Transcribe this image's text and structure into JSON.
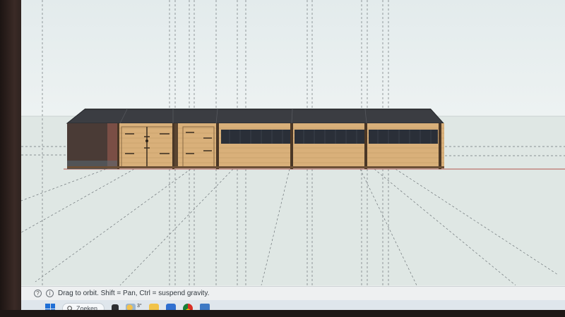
{
  "status_bar": {
    "info_icon": "info-circle-icon",
    "hint_text": "Drag to orbit. Shift = Pan, Ctrl = suspend gravity."
  },
  "taskbar": {
    "search_placeholder": "Zoeken",
    "weather_temp": "3°",
    "icons": [
      "windows-start-icon",
      "search-icon",
      "taskview-icon",
      "weather-icon",
      "file-explorer-icon",
      "mail-icon",
      "chrome-icon",
      "sketchup-icon"
    ]
  },
  "model": {
    "description_colors": {
      "roof": "#3b3d42",
      "wood": "#d9b07a",
      "window_band": "#2a2f38",
      "open_bay": "#4a3b36"
    }
  }
}
